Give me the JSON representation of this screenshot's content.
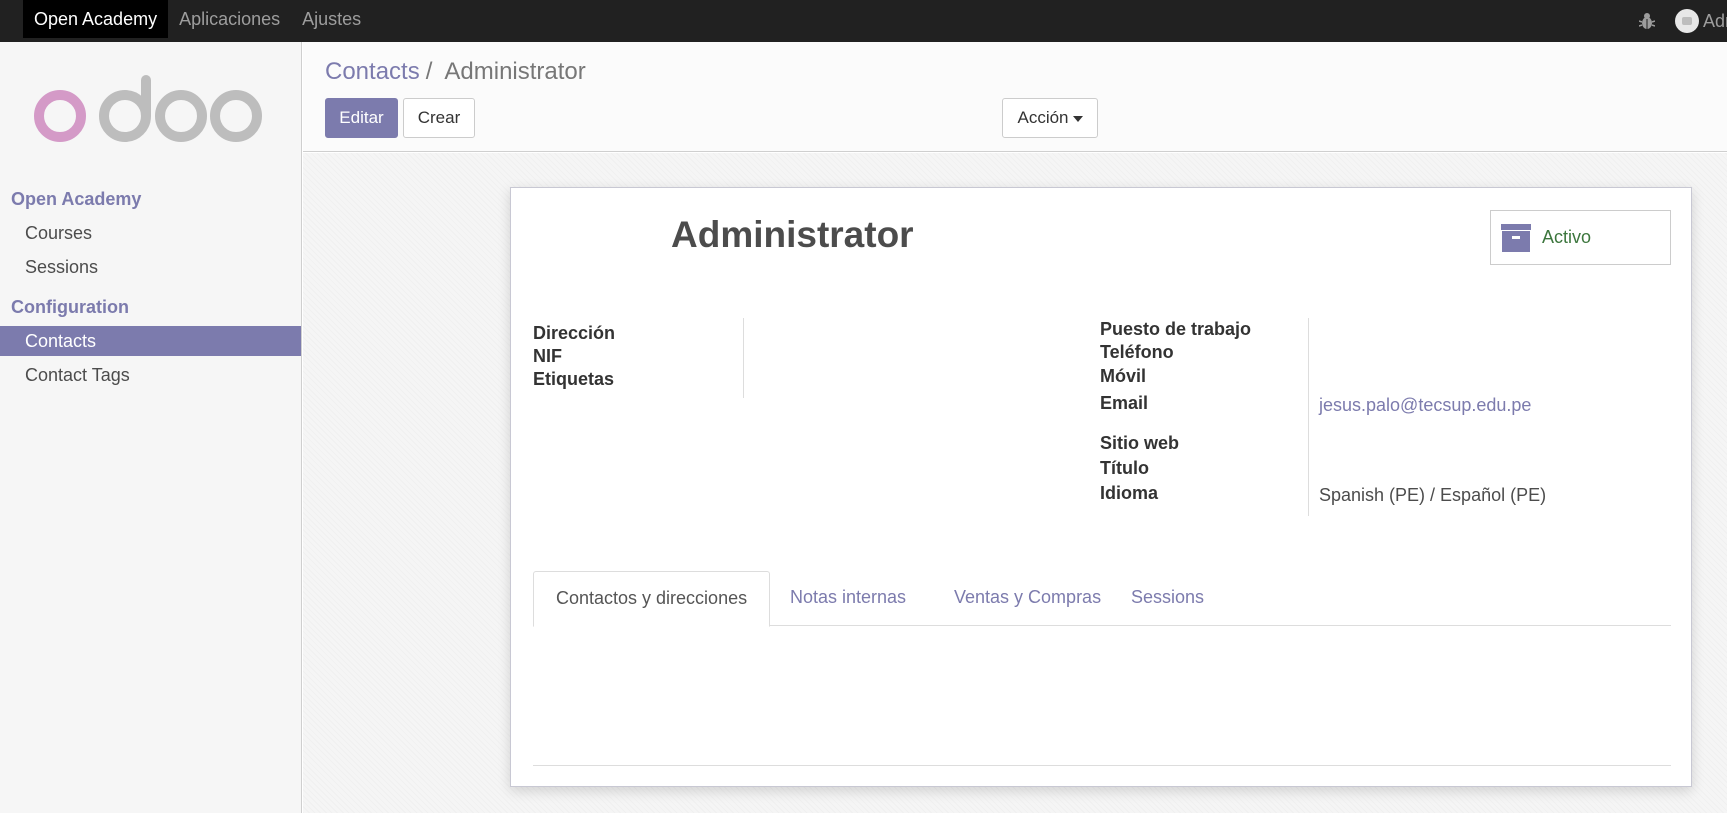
{
  "topbar": {
    "brand": "Open Academy",
    "menu": [
      "Aplicaciones",
      "Ajustes"
    ],
    "user_name": "Administrator"
  },
  "sidebar": {
    "logo_text": "odoo",
    "sections": [
      {
        "title": "Open Academy",
        "items": [
          "Courses",
          "Sessions"
        ]
      },
      {
        "title": "Configuration",
        "items": [
          "Contacts",
          "Contact Tags"
        ]
      }
    ],
    "active_item": "Contacts"
  },
  "control_panel": {
    "breadcrumb_parent": "Contacts",
    "breadcrumb_sep": "/",
    "breadcrumb_current": "Administrator",
    "edit_label": "Editar",
    "create_label": "Crear",
    "action_label": "Acción"
  },
  "record": {
    "name": "Administrator",
    "active_label": "Activo",
    "left_fields": {
      "address_label": "Dirección",
      "vat_label": "NIF",
      "tags_label": "Etiquetas"
    },
    "right_fields": {
      "job_label": "Puesto de trabajo",
      "phone_label": "Teléfono",
      "mobile_label": "Móvil",
      "email_label": "Email",
      "email_value": "jesus.palo@tecsup.edu.pe",
      "website_label": "Sitio web",
      "title_label": "Título",
      "lang_label": "Idioma",
      "lang_value": "Spanish (PE) / Español (PE)"
    },
    "tabs": [
      "Contactos y direcciones",
      "Notas internas",
      "Ventas y Compras",
      "Sessions"
    ],
    "active_tab": "Contactos y direcciones"
  },
  "colors": {
    "primary": "#7c7bad",
    "navbar": "#212121",
    "active_status": "#3c763d"
  },
  "icons": {
    "debug": "bug-icon",
    "archive": "archive-icon",
    "avatar": "user-avatar-icon"
  }
}
